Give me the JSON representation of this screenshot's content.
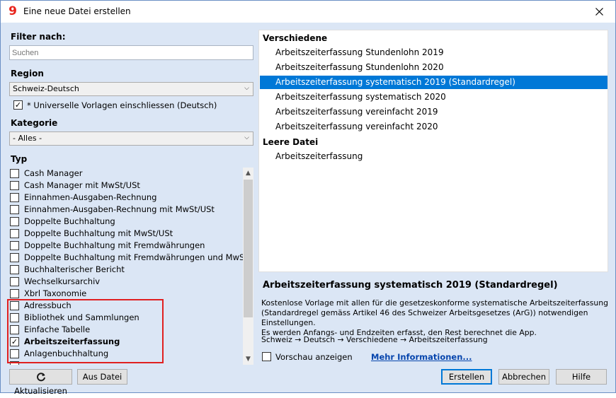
{
  "window": {
    "title": "Eine neue Datei erstellen",
    "app_icon_glyph": "9"
  },
  "filter": {
    "label": "Filter nach:",
    "search_placeholder": "Suchen"
  },
  "region": {
    "label": "Region",
    "selected": "Schweiz-Deutsch",
    "universal_checkbox_label": "* Universelle Vorlagen einschliessen (Deutsch)",
    "universal_checked": true
  },
  "kategorie": {
    "label": "Kategorie",
    "selected": "- Alles -"
  },
  "typ": {
    "label": "Typ",
    "items": [
      {
        "label": "Cash Manager",
        "checked": false,
        "bold": false
      },
      {
        "label": "Cash Manager mit MwSt/USt",
        "checked": false,
        "bold": false
      },
      {
        "label": "Einnahmen-Ausgaben-Rechnung",
        "checked": false,
        "bold": false
      },
      {
        "label": "Einnahmen-Ausgaben-Rechnung mit MwSt/USt",
        "checked": false,
        "bold": false
      },
      {
        "label": "Doppelte Buchhaltung",
        "checked": false,
        "bold": false
      },
      {
        "label": "Doppelte Buchhaltung mit MwSt/USt",
        "checked": false,
        "bold": false
      },
      {
        "label": "Doppelte Buchhaltung mit Fremdwährungen",
        "checked": false,
        "bold": false
      },
      {
        "label": "Doppelte Buchhaltung mit Fremdwährungen und MwSt/U",
        "checked": false,
        "bold": false
      },
      {
        "label": "Buchhalterischer Bericht",
        "checked": false,
        "bold": false
      },
      {
        "label": "Wechselkursarchiv",
        "checked": false,
        "bold": false
      },
      {
        "label": "Xbrl Taxonomie",
        "checked": false,
        "bold": false
      },
      {
        "label": "Adressbuch",
        "checked": false,
        "bold": false
      },
      {
        "label": "Bibliothek und Sammlungen",
        "checked": false,
        "bold": false
      },
      {
        "label": "Einfache Tabelle",
        "checked": false,
        "bold": false
      },
      {
        "label": "Arbeitszeiterfassung",
        "checked": true,
        "bold": true
      },
      {
        "label": "Anlagenbuchhaltung",
        "checked": false,
        "bold": false
      }
    ]
  },
  "buttons": {
    "refresh": "Aktualisieren",
    "from_file": "Aus Datei",
    "create": "Erstellen",
    "cancel": "Abbrechen",
    "help": "Hilfe"
  },
  "templates": {
    "group1": "Verschiedene",
    "group1_items": [
      "Arbeitszeiterfassung Stundenlohn 2019",
      "Arbeitszeiterfassung Stundenlohn 2020",
      "Arbeitszeiterfassung systematisch 2019 (Standardregel)",
      "Arbeitszeiterfassung systematisch 2020",
      "Arbeitszeiterfassung vereinfacht 2019",
      "Arbeitszeiterfassung vereinfacht 2020"
    ],
    "selected_index": 2,
    "group2": "Leere Datei",
    "group2_items": [
      "Arbeitszeiterfassung"
    ]
  },
  "description": {
    "title": "Arbeitszeiterfassung systematisch 2019 (Standardregel)",
    "line1": "Kostenlose Vorlage mit allen für die gesetzeskonforme systematische Arbeitszeiterfassung",
    "line2": "(Standardregel gemäss Artikel 46 des Schweizer Arbeitsgesetzes (ArG)) notwendigen Einstellungen.",
    "line3": "Es werden Anfangs- und Endzeiten erfasst, den Rest berechnet die App.",
    "path": "Schweiz → Deutsch → Verschiedene → Arbeitszeiterfassung",
    "preview_label": "Vorschau anzeigen",
    "preview_checked": false,
    "more_info": "Mehr Informationen..."
  },
  "colors": {
    "panel_bg": "#dbe6f5",
    "selection": "#0078d7",
    "highlight_border": "#e02020",
    "link": "#0645ad"
  }
}
